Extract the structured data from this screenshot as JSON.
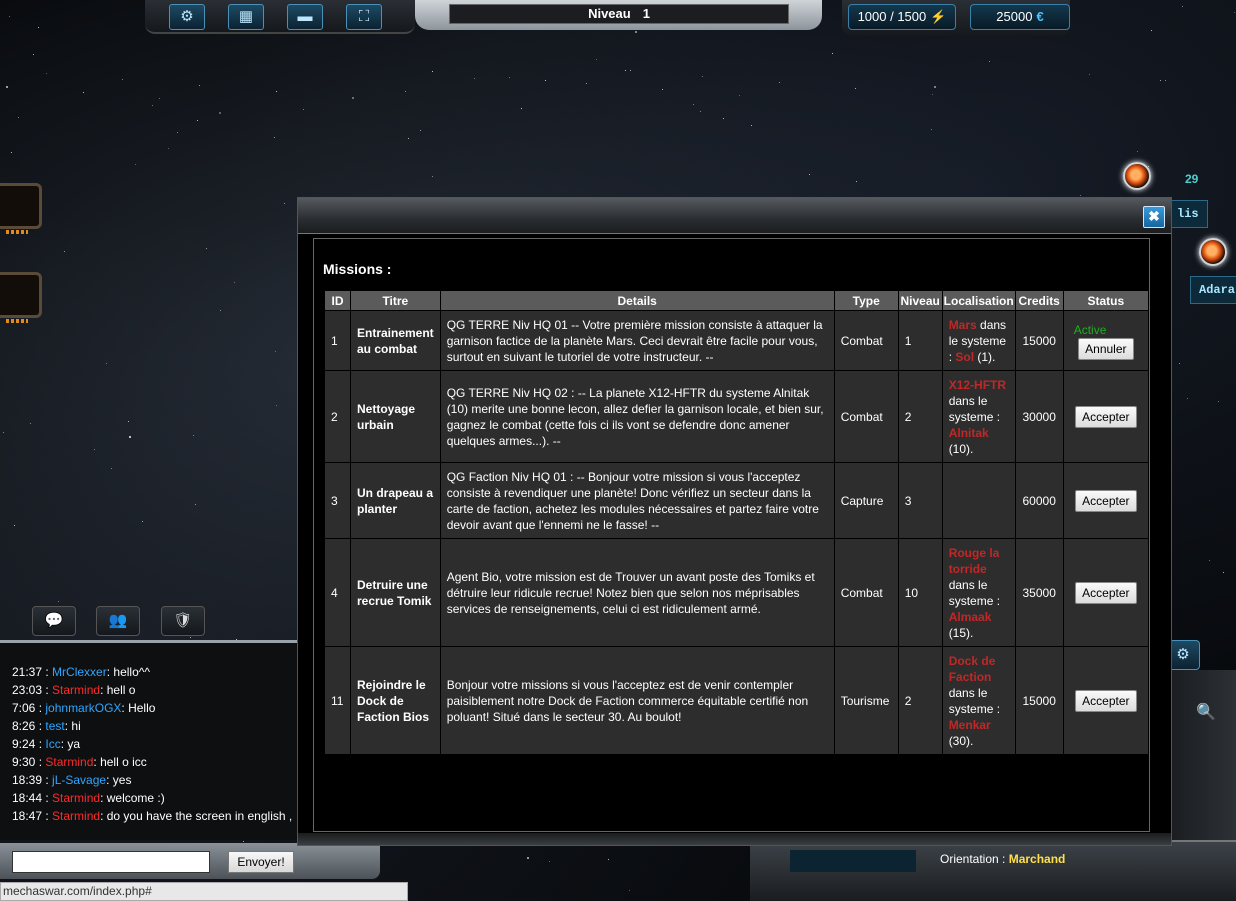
{
  "topbar": {
    "buttons": [
      {
        "icon": "gear-icon",
        "glyph": "⚙"
      },
      {
        "icon": "grid-icon",
        "glyph": "▦"
      },
      {
        "icon": "save-icon",
        "glyph": "▬"
      },
      {
        "icon": "fullscreen-icon",
        "glyph": "⛶"
      }
    ],
    "level_label": "Niveau",
    "level_value": "1",
    "energy": "1000 / 1500",
    "energy_icon": "⚡",
    "credits": "25000",
    "credits_icon": "€"
  },
  "map": {
    "label_1": "lis",
    "label_2": "Adara",
    "number": "29"
  },
  "modal": {
    "close": "✖",
    "title": "Missions :",
    "columns": [
      "ID",
      "Titre",
      "Details",
      "Type",
      "Niveau",
      "Localisation",
      "Credits",
      "Status"
    ],
    "rows": [
      {
        "id": "1",
        "title": "Entrainement au combat",
        "details": "QG TERRE Niv HQ 01 -- Votre première mission consiste à attaquer la garnison factice de la planète Mars. Ceci devrait être facile pour vous, surtout en suivant le tutoriel de votre instructeur. --",
        "type": "Combat",
        "level": "1",
        "loc_place": "Mars",
        "loc_mid": " dans le systeme : ",
        "loc_system": "Sol",
        "loc_num": " (1).",
        "credits": "15000",
        "status_text": "Active",
        "button": "Annuler"
      },
      {
        "id": "2",
        "title": "Nettoyage urbain",
        "details": "QG TERRE Niv HQ 02 : -- La planete X12-HFTR du systeme Alnitak (10) merite une bonne lecon, allez defier la garnison locale, et bien sur, gagnez le combat (cette fois ci ils vont se defendre donc amener quelques armes...). --",
        "type": "Combat",
        "level": "2",
        "loc_place": "X12-HFTR",
        "loc_mid": " dans le systeme : ",
        "loc_system": "Alnitak",
        "loc_num": " (10).",
        "credits": "30000",
        "status_text": "",
        "button": "Accepter"
      },
      {
        "id": "3",
        "title": "Un drapeau a planter",
        "details": "QG Faction Niv HQ 01 : -- Bonjour votre mission si vous l'acceptez consiste à revendiquer une planète! Donc vérifiez un secteur dans la carte de faction, achetez les modules nécessaires et partez faire votre devoir avant que l'ennemi ne le fasse! --",
        "type": "Capture",
        "level": "3",
        "loc_place": "",
        "loc_mid": "",
        "loc_system": "",
        "loc_num": "",
        "credits": "60000",
        "status_text": "",
        "button": "Accepter"
      },
      {
        "id": "4",
        "title": "Detruire une recrue Tomik",
        "details": "Agent Bio, votre mission est de Trouver un avant poste des Tomiks et détruire leur ridicule recrue! Notez bien que selon nos méprisables services de renseignements, celui ci est ridiculement armé.",
        "type": "Combat",
        "level": "10",
        "loc_place": "Rouge la torride",
        "loc_mid": " dans le systeme : ",
        "loc_system": "Almaak",
        "loc_num": " (15).",
        "credits": "35000",
        "status_text": "",
        "button": "Accepter"
      },
      {
        "id": "11",
        "title": "Rejoindre le Dock de Faction Bios",
        "details": "Bonjour votre missions si vous l'acceptez est de venir contempler paisiblement notre Dock de Faction commerce équitable certifié non poluant! Situé dans le secteur 30. Au boulot!",
        "type": "Tourisme",
        "level": "2",
        "loc_place": "Dock de Faction",
        "loc_mid": " dans le systeme : ",
        "loc_system": "Menkar",
        "loc_num": " (30).",
        "credits": "15000",
        "status_text": "",
        "button": "Accepter"
      }
    ]
  },
  "chat": {
    "tabs": [
      {
        "icon": "chat-icon",
        "glyph": "💬"
      },
      {
        "icon": "group-icon",
        "glyph": "👥"
      },
      {
        "icon": "shield-icon",
        "glyph": "🛡"
      }
    ],
    "messages": [
      {
        "time": "21:37",
        "user": "MrClexxer",
        "mod": false,
        "text": "hello^^"
      },
      {
        "time": "23:03",
        "user": "Starmind",
        "mod": true,
        "text": "hell o"
      },
      {
        "time": "7:06",
        "user": "johnmarkOGX",
        "mod": false,
        "text": "Hello"
      },
      {
        "time": "8:26",
        "user": "test",
        "mod": false,
        "text": "hi"
      },
      {
        "time": "9:24",
        "user": "Icc",
        "mod": false,
        "text": "ya"
      },
      {
        "time": "9:30",
        "user": "Starmind",
        "mod": true,
        "text": "hell o icc"
      },
      {
        "time": "18:39",
        "user": "jL-Savage",
        "mod": false,
        "text": "yes"
      },
      {
        "time": "18:44",
        "user": "Starmind",
        "mod": true,
        "text": "welcome :)"
      },
      {
        "time": "18:47",
        "user": "Starmind",
        "mod": true,
        "text": "do you have the screen in english ,"
      }
    ],
    "input_value": "",
    "send_label": "Envoyer!"
  },
  "bottom_right": {
    "orientation_label": "Orientation : ",
    "orientation_value": "Marchand",
    "gear_glyph": "⚙",
    "zoom_glyph": "🔍"
  },
  "statusbar": {
    "url": "mechaswar.com/index.php#"
  }
}
